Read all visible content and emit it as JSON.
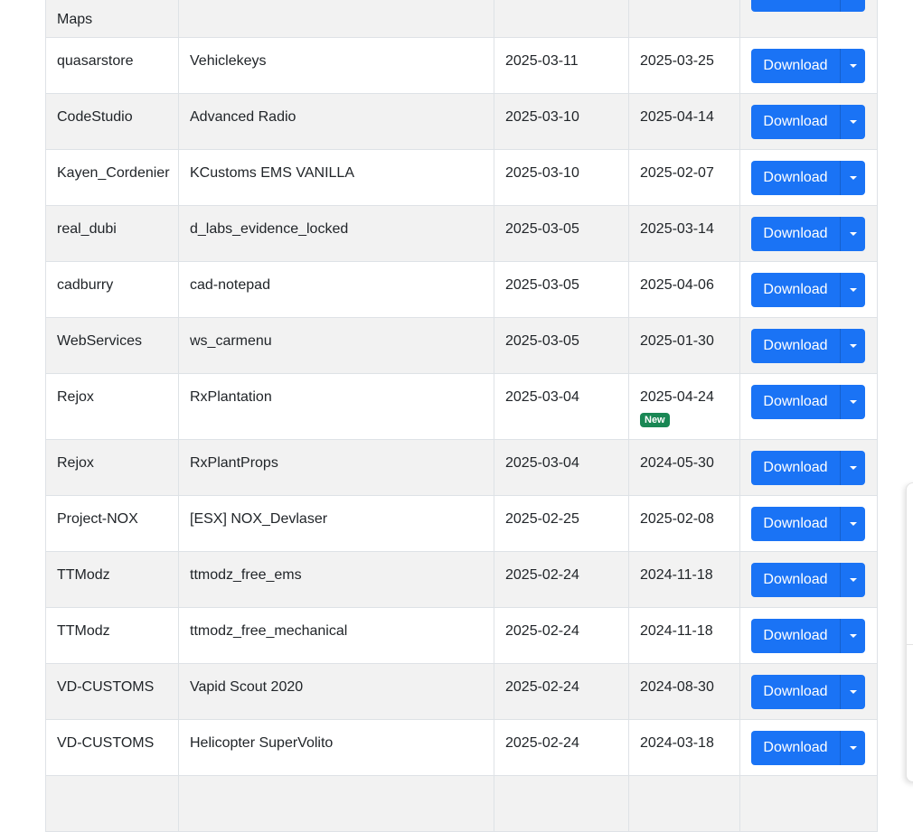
{
  "download_label": "Download",
  "new_label": "New",
  "rows": [
    {
      "author": "",
      "name": "",
      "released": "",
      "updated": "",
      "is_new": false,
      "first_line": "Maps"
    },
    {
      "author": "quasarstore",
      "name": "Vehiclekeys",
      "released": "2025-03-11",
      "updated": "2025-03-25",
      "is_new": false
    },
    {
      "author": "CodeStudio",
      "name": "Advanced Radio",
      "released": "2025-03-10",
      "updated": "2025-04-14",
      "is_new": false
    },
    {
      "author": "Kayen_Cordenier",
      "name": "KCustoms EMS VANILLA",
      "released": "2025-03-10",
      "updated": "2025-02-07",
      "is_new": false
    },
    {
      "author": "real_dubi",
      "name": "d_labs_evidence_locked",
      "released": "2025-03-05",
      "updated": "2025-03-14",
      "is_new": false
    },
    {
      "author": "cadburry",
      "name": "cad-notepad",
      "released": "2025-03-05",
      "updated": "2025-04-06",
      "is_new": false
    },
    {
      "author": "WebServices",
      "name": "ws_carmenu",
      "released": "2025-03-05",
      "updated": "2025-01-30",
      "is_new": false
    },
    {
      "author": "Rejox",
      "name": "RxPlantation",
      "released": "2025-03-04",
      "updated": "2025-04-24",
      "is_new": true
    },
    {
      "author": "Rejox",
      "name": "RxPlantProps",
      "released": "2025-03-04",
      "updated": "2024-05-30",
      "is_new": false
    },
    {
      "author": "Project-NOX",
      "name": "[ESX] NOX_Devlaser",
      "released": "2025-02-25",
      "updated": "2025-02-08",
      "is_new": false
    },
    {
      "author": "TTModz",
      "name": "ttmodz_free_ems",
      "released": "2025-02-24",
      "updated": "2024-11-18",
      "is_new": false
    },
    {
      "author": "TTModz",
      "name": "ttmodz_free_mechanical",
      "released": "2025-02-24",
      "updated": "2024-11-18",
      "is_new": false
    },
    {
      "author": "VD-CUSTOMS",
      "name": "Vapid Scout 2020",
      "released": "2025-02-24",
      "updated": "2024-08-30",
      "is_new": false
    },
    {
      "author": "VD-CUSTOMS",
      "name": "Helicopter SuperVolito",
      "released": "2025-02-24",
      "updated": "2024-03-18",
      "is_new": false
    },
    {
      "author": "",
      "name": "",
      "released": "",
      "updated": "",
      "is_new": false
    }
  ],
  "colors": {
    "button": "#1a73f5",
    "badge_new": "#198754",
    "row_stripe": "#f2f2f2",
    "border": "#dee2e6"
  },
  "icons": {
    "dropdown": "caret-down-icon"
  }
}
